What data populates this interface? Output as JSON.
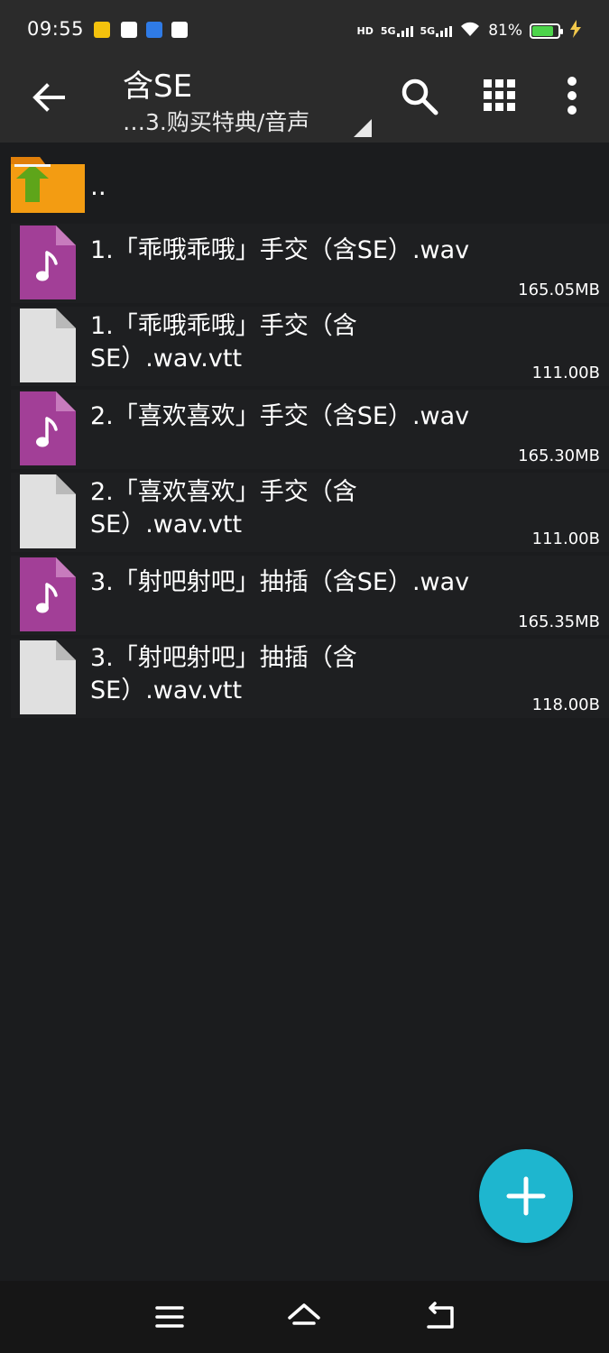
{
  "status_bar": {
    "time": "09:55",
    "hd_label": "HD",
    "network_1": "5G",
    "network_2": "5G",
    "battery_percent_label": "81%",
    "battery_level": 0.81,
    "icons": [
      "meituan-icon",
      "message-icon",
      "browser-icon",
      "sync-icon",
      "wifi-icon",
      "battery-icon",
      "charging-icon"
    ]
  },
  "toolbar": {
    "title": "含SE",
    "path": "…3.购买特典/音声",
    "icons": [
      "back-arrow-icon",
      "search-icon",
      "grid-view-icon",
      "more-vert-icon"
    ]
  },
  "parent_entry": {
    "label": ".."
  },
  "files": [
    {
      "name": "1.「乖哦乖哦」手交（含SE）.wav",
      "size": "165.05MB",
      "type": "audio"
    },
    {
      "name": "1.「乖哦乖哦」手交（含SE）.wav.vtt",
      "size": "111.00B",
      "type": "document"
    },
    {
      "name": "2.「喜欢喜欢」手交（含SE）.wav",
      "size": "165.30MB",
      "type": "audio"
    },
    {
      "name": "2.「喜欢喜欢」手交（含SE）.wav.vtt",
      "size": "111.00B",
      "type": "document"
    },
    {
      "name": "3.「射吧射吧」抽插（含SE）.wav",
      "size": "165.35MB",
      "type": "audio"
    },
    {
      "name": "3.「射吧射吧」抽插（含SE）.wav.vtt",
      "size": "118.00B",
      "type": "document"
    }
  ],
  "colors": {
    "background": "#1b1c1e",
    "toolbar": "#2b2b2b",
    "audio_icon": "#a23f97",
    "document_icon": "#e0e0e0",
    "folder": "#f39c12",
    "up_arrow": "#5ea51a",
    "fab": "#1eb6cf",
    "battery": "#4cd44a"
  }
}
